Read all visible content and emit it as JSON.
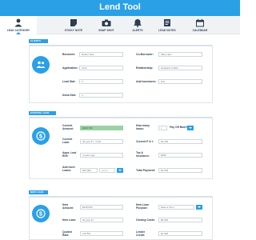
{
  "app": {
    "title": "Lend Tool"
  },
  "tabs": [
    {
      "label": "LEAD CATEGORY",
      "icon": "person-icon",
      "active": true
    },
    {
      "label": "STICKY NOTE",
      "icon": "sticky-note-icon",
      "active": false
    },
    {
      "label": "SNAP SHOT",
      "icon": "camera-icon",
      "active": false
    },
    {
      "label": "ALERTS",
      "icon": "bell-icon",
      "active": false
    },
    {
      "label": "LEAD NOTES",
      "icon": "notes-icon",
      "active": false
    },
    {
      "label": "CALENDAR",
      "icon": "calendar-icon",
      "active": false
    }
  ],
  "clients": {
    "label": "CLIENTS",
    "icon": "people-icon",
    "borrower": {
      "label": "Borrower:",
      "placeholder": "Robert Hein"
    },
    "co_borrower": {
      "label": "Co-Borrower:",
      "placeholder": "Mary Hein"
    },
    "application": {
      "label": "Application:",
      "placeholder": "Joint"
    },
    "relationship": {
      "label": "Relationship:",
      "placeholder": "Husband & Wife"
    },
    "lead_stat": {
      "label": "Lead Stat:",
      "placeholder": "3"
    },
    "add_borrowers": {
      "label": "Add borrowers:",
      "placeholder": "N/A"
    },
    "dona_stat": {
      "label": "Dona Stat:",
      "placeholder": "4"
    }
  },
  "existing_loan": {
    "label": "EXISTING LOAN",
    "icon": "dollar-icon",
    "current_amount": {
      "label": "Current Amount:",
      "value": "$209,760"
    },
    "how_many_loans": {
      "label": "How many loans:",
      "value": "2"
    },
    "pay_off_both": {
      "label": "Pay Off Both?",
      "value": ""
    },
    "current_loan": {
      "label": "Current Loan:",
      "placeholder": "30 year fix - 5.0%"
    },
    "current_p_i": {
      "label": "Current P & I:",
      "placeholder": "$1,230"
    },
    "appx_last_refi": {
      "label": "Appx. Last Refi:",
      "placeholder": "4 years ago"
    },
    "tax_insurance": {
      "label": "Tax & Insurance:",
      "placeholder": "$300"
    },
    "add_more_loans": {
      "label": "Add more Loans:",
      "placeholder": "$34,000",
      "select_value": "Heloc"
    },
    "total_payment": {
      "label": "Total Payment:",
      "placeholder": "$1,530"
    }
  },
  "new_loan": {
    "label": "NEW LOAN",
    "icon": "dollar-icon",
    "new_amount": {
      "label": "New Amount:",
      "placeholder": "$228,000"
    },
    "new_loan_purpose": {
      "label": "New Loan Purpose:",
      "placeholder": "Rate & Term"
    },
    "new_loan": {
      "label": "New Loan:",
      "placeholder": "30 year fix"
    },
    "closing_costs": {
      "label": "Closing Costs:",
      "placeholder": "$5,000"
    },
    "quoted_rate": {
      "label": "Quoted Rate:",
      "placeholder": "3.875%"
    },
    "lender_credit": {
      "label": "Lender Credit:",
      "placeholder": "$1,500"
    }
  }
}
